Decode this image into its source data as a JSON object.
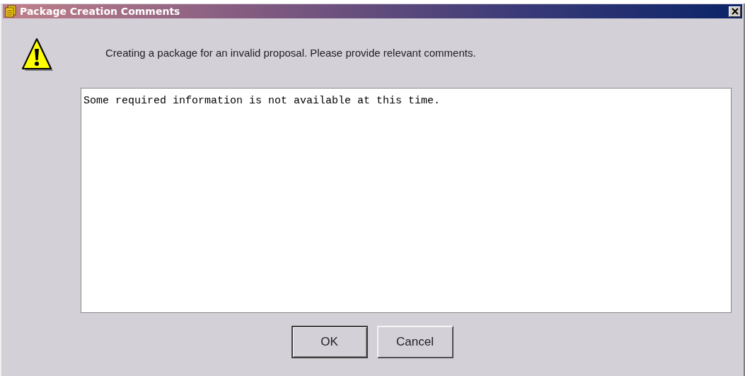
{
  "window": {
    "title": "Package Creation Comments"
  },
  "message": "Creating a package for an invalid proposal. Please provide relevant comments.",
  "comments": {
    "value": "Some required information is not available at this time."
  },
  "buttons": [
    {
      "label": "OK",
      "default": true
    },
    {
      "label": "Cancel",
      "default": false
    }
  ]
}
